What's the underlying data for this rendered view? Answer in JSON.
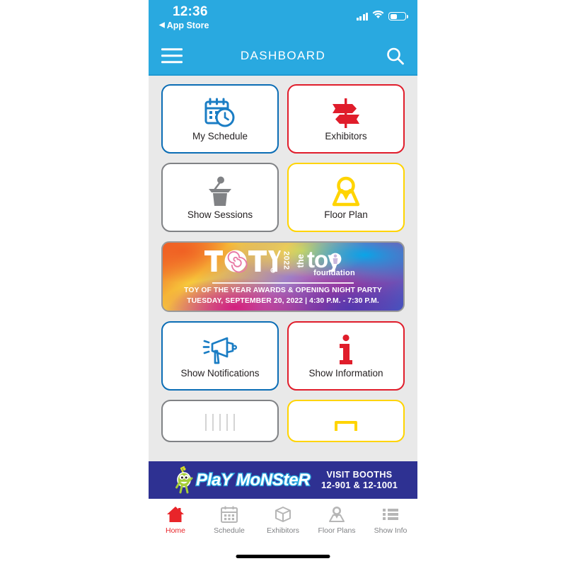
{
  "status_bar": {
    "time": "12:36",
    "back_label": "App Store",
    "back_arrow": "◀",
    "signal_icon": "cellular-signal-icon",
    "wifi_icon": "wifi-icon",
    "battery_icon": "battery-icon"
  },
  "nav": {
    "title": "DASHBOARD",
    "menu_icon": "hamburger-menu-icon",
    "search_icon": "search-icon"
  },
  "tiles": [
    {
      "label": "My Schedule",
      "color": "blue",
      "border_hex": "#0B6DB5",
      "icon": "calendar-clock-icon"
    },
    {
      "label": "Exhibitors",
      "color": "red",
      "border_hex": "#E01D2B",
      "icon": "signpost-icon"
    },
    {
      "label": "Show Sessions",
      "color": "gray",
      "border_hex": "#808285",
      "icon": "podium-microphone-icon"
    },
    {
      "label": "Floor Plan",
      "color": "yellow",
      "border_hex": "#FFD400",
      "icon": "map-pin-icon"
    },
    {
      "label": "Show Notifications",
      "color": "blue",
      "border_hex": "#0B6DB5",
      "icon": "megaphone-icon"
    },
    {
      "label": "Show Information",
      "color": "red",
      "border_hex": "#E01D2B",
      "icon": "info-i-icon"
    }
  ],
  "cut_tiles": [
    {
      "color": "gray",
      "border_hex": "#808285",
      "icon": "partially-visible-icon"
    },
    {
      "color": "yellow",
      "border_hex": "#FFD400",
      "icon": "partially-visible-icon"
    }
  ],
  "promo": {
    "toty_text": "T⊚TY",
    "toty_registered": "®",
    "year": "2022",
    "tf_the": "the",
    "tf_toy": "toy",
    "tf_foundation": "foundation",
    "tf_tm": "™",
    "line1": "TOY OF THE YEAR AWARDS & OPENING NIGHT PARTY",
    "line2": "TUESDAY, SEPTEMBER 20, 2022  |  4:30 P.M. - 7:30 P.M."
  },
  "ad": {
    "brand": "PlaY MoNSteR",
    "registered": "®",
    "booth_top": "VISIT BOOTHS",
    "booth_bottom": "12-901 & 12-1001",
    "mascot_icon": "playmonster-mascot-icon",
    "background_hex": "#2E3192"
  },
  "tabs": [
    {
      "label": "Home",
      "icon": "home-icon",
      "active": true
    },
    {
      "label": "Schedule",
      "icon": "calendar-icon",
      "active": false
    },
    {
      "label": "Exhibitors",
      "icon": "box-icon",
      "active": false
    },
    {
      "label": "Floor Plans",
      "icon": "map-pin-icon",
      "active": false
    },
    {
      "label": "Show Info",
      "icon": "list-icon",
      "active": false
    }
  ]
}
